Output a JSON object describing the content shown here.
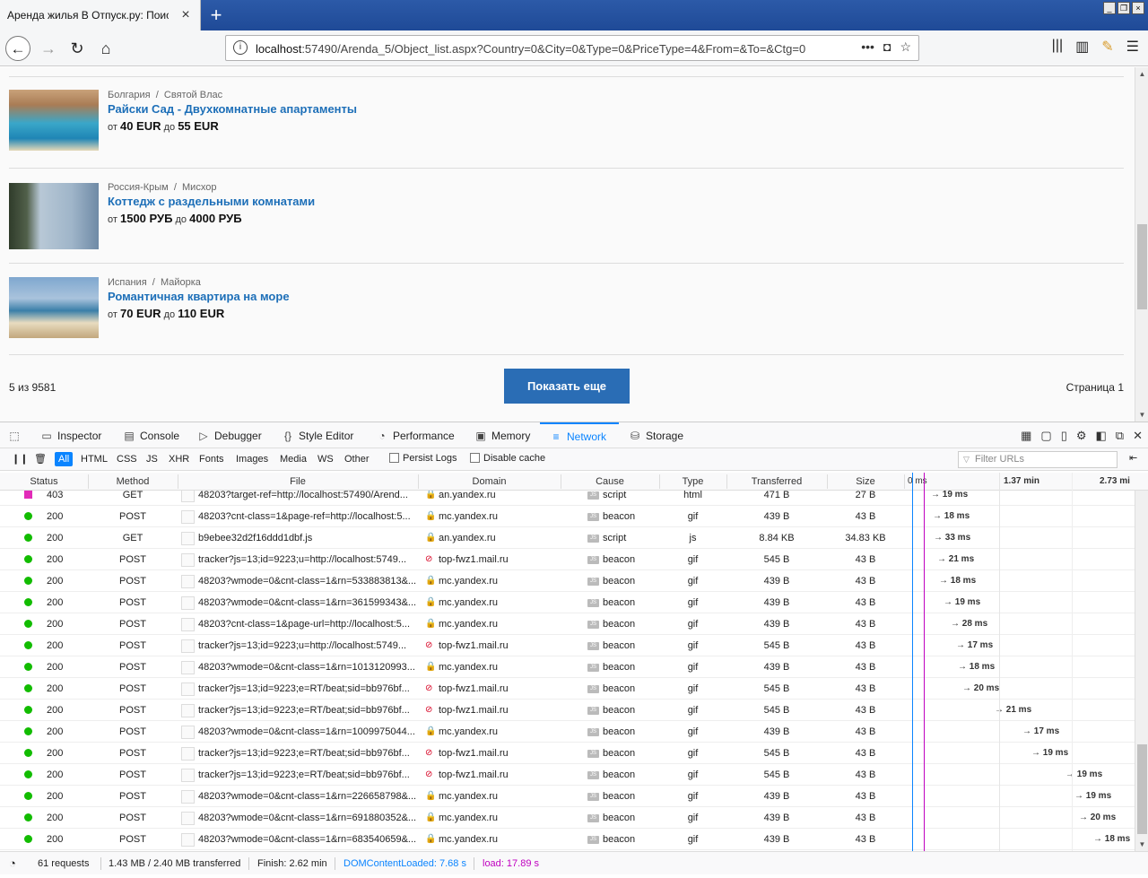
{
  "browser": {
    "tab_title": "Аренда жилья В Отпуск.ру: Поиск об",
    "url_host": "localhost",
    "url_rest": ":57490/Arenda_5/Object_list.aspx?Country=0&City=0&Type=0&PriceType=4&From=&To=&Ctg=0"
  },
  "listing": {
    "items": [
      {
        "country": "Болгария",
        "city": "Святой Влас",
        "title": "Райски Сад - Двухкомнатные апартаменты",
        "from_label": "от",
        "price_from": "40 EUR",
        "to_label": "до",
        "price_to": "55 EUR"
      },
      {
        "country": "Россия-Крым",
        "city": "Мисхор",
        "title": "Коттедж с раздельными комнатами",
        "from_label": "от",
        "price_from": "1500 РУБ",
        "to_label": "до",
        "price_to": "4000 РУБ"
      },
      {
        "country": "Испания",
        "city": "Майорка",
        "title": "Романтичная квартира на море",
        "from_label": "от",
        "price_from": "70 EUR",
        "to_label": "до",
        "price_to": "110 EUR"
      }
    ],
    "count": "5 из 9581",
    "more_button": "Показать еще",
    "page": "Страница 1"
  },
  "devtools": {
    "tabs": [
      "Inspector",
      "Console",
      "Debugger",
      "Style Editor",
      "Performance",
      "Memory",
      "Network",
      "Storage"
    ],
    "filters": [
      "All",
      "HTML",
      "CSS",
      "JS",
      "XHR",
      "Fonts",
      "Images",
      "Media",
      "WS",
      "Other"
    ],
    "persist_logs": "Persist Logs",
    "disable_cache": "Disable cache",
    "filter_placeholder": "Filter URLs",
    "columns": [
      "Status",
      "Method",
      "File",
      "Domain",
      "Cause",
      "Type",
      "Transferred",
      "Size"
    ],
    "timeline_ticks": [
      "0 ms",
      "1.37 min",
      "2.73 mi"
    ],
    "requests": [
      {
        "status": "403",
        "method": "GET",
        "file": "48203?target-ref=http://localhost:57490/Arend...",
        "domain": "an.yandex.ru",
        "secure": true,
        "cause": "script",
        "type": "html",
        "transferred": "471 B",
        "size": "27 B",
        "time": "19 ms",
        "wf": 1038
      },
      {
        "status": "200",
        "method": "POST",
        "file": "48203?cnt-class=1&page-ref=http://localhost:5...",
        "domain": "mc.yandex.ru",
        "secure": true,
        "cause": "beacon",
        "type": "gif",
        "transferred": "439 B",
        "size": "43 B",
        "time": "18 ms",
        "wf": 1040
      },
      {
        "status": "200",
        "method": "GET",
        "file": "b9ebee32d2f16ddd1dbf.js",
        "domain": "an.yandex.ru",
        "secure": true,
        "cause": "script",
        "type": "js",
        "transferred": "8.84 KB",
        "size": "34.83 KB",
        "time": "33 ms",
        "wf": 1041
      },
      {
        "status": "200",
        "method": "POST",
        "file": "tracker?js=13;id=9223;u=http://localhost:5749...",
        "domain": "top-fwz1.mail.ru",
        "secure": false,
        "cause": "beacon",
        "type": "gif",
        "transferred": "545 B",
        "size": "43 B",
        "time": "21 ms",
        "wf": 1045
      },
      {
        "status": "200",
        "method": "POST",
        "file": "48203?wmode=0&cnt-class=1&rn=533883813&...",
        "domain": "mc.yandex.ru",
        "secure": true,
        "cause": "beacon",
        "type": "gif",
        "transferred": "439 B",
        "size": "43 B",
        "time": "18 ms",
        "wf": 1047
      },
      {
        "status": "200",
        "method": "POST",
        "file": "48203?wmode=0&cnt-class=1&rn=361599343&...",
        "domain": "mc.yandex.ru",
        "secure": true,
        "cause": "beacon",
        "type": "gif",
        "transferred": "439 B",
        "size": "43 B",
        "time": "19 ms",
        "wf": 1052
      },
      {
        "status": "200",
        "method": "POST",
        "file": "48203?cnt-class=1&page-url=http://localhost:5...",
        "domain": "mc.yandex.ru",
        "secure": true,
        "cause": "beacon",
        "type": "gif",
        "transferred": "439 B",
        "size": "43 B",
        "time": "28 ms",
        "wf": 1060
      },
      {
        "status": "200",
        "method": "POST",
        "file": "tracker?js=13;id=9223;u=http://localhost:5749...",
        "domain": "top-fwz1.mail.ru",
        "secure": false,
        "cause": "beacon",
        "type": "gif",
        "transferred": "545 B",
        "size": "43 B",
        "time": "17 ms",
        "wf": 1066
      },
      {
        "status": "200",
        "method": "POST",
        "file": "48203?wmode=0&cnt-class=1&rn=1013120993...",
        "domain": "mc.yandex.ru",
        "secure": true,
        "cause": "beacon",
        "type": "gif",
        "transferred": "439 B",
        "size": "43 B",
        "time": "18 ms",
        "wf": 1068
      },
      {
        "status": "200",
        "method": "POST",
        "file": "tracker?js=13;id=9223;e=RT/beat;sid=bb976bf...",
        "domain": "top-fwz1.mail.ru",
        "secure": false,
        "cause": "beacon",
        "type": "gif",
        "transferred": "545 B",
        "size": "43 B",
        "time": "20 ms",
        "wf": 1073
      },
      {
        "status": "200",
        "method": "POST",
        "file": "tracker?js=13;id=9223;e=RT/beat;sid=bb976bf...",
        "domain": "top-fwz1.mail.ru",
        "secure": false,
        "cause": "beacon",
        "type": "gif",
        "transferred": "545 B",
        "size": "43 B",
        "time": "21 ms",
        "wf": 1109
      },
      {
        "status": "200",
        "method": "POST",
        "file": "48203?wmode=0&cnt-class=1&rn=1009975044...",
        "domain": "mc.yandex.ru",
        "secure": true,
        "cause": "beacon",
        "type": "gif",
        "transferred": "439 B",
        "size": "43 B",
        "time": "17 ms",
        "wf": 1140
      },
      {
        "status": "200",
        "method": "POST",
        "file": "tracker?js=13;id=9223;e=RT/beat;sid=bb976bf...",
        "domain": "top-fwz1.mail.ru",
        "secure": false,
        "cause": "beacon",
        "type": "gif",
        "transferred": "545 B",
        "size": "43 B",
        "time": "19 ms",
        "wf": 1150
      },
      {
        "status": "200",
        "method": "POST",
        "file": "tracker?js=13;id=9223;e=RT/beat;sid=bb976bf...",
        "domain": "top-fwz1.mail.ru",
        "secure": false,
        "cause": "beacon",
        "type": "gif",
        "transferred": "545 B",
        "size": "43 B",
        "time": "19 ms",
        "wf": 1188
      },
      {
        "status": "200",
        "method": "POST",
        "file": "48203?wmode=0&cnt-class=1&rn=226658798&...",
        "domain": "mc.yandex.ru",
        "secure": true,
        "cause": "beacon",
        "type": "gif",
        "transferred": "439 B",
        "size": "43 B",
        "time": "19 ms",
        "wf": 1198
      },
      {
        "status": "200",
        "method": "POST",
        "file": "48203?wmode=0&cnt-class=1&rn=691880352&...",
        "domain": "mc.yandex.ru",
        "secure": true,
        "cause": "beacon",
        "type": "gif",
        "transferred": "439 B",
        "size": "43 B",
        "time": "20 ms",
        "wf": 1203
      },
      {
        "status": "200",
        "method": "POST",
        "file": "48203?wmode=0&cnt-class=1&rn=683540659&...",
        "domain": "mc.yandex.ru",
        "secure": true,
        "cause": "beacon",
        "type": "gif",
        "transferred": "439 B",
        "size": "43 B",
        "time": "18 ms",
        "wf": 1219
      }
    ],
    "summary": {
      "requests": "61 requests",
      "transferred": "1.43 MB / 2.40 MB transferred",
      "finish": "Finish: 2.62 min",
      "dom": "DOMContentLoaded: 7.68 s",
      "load": "load: 17.89 s"
    }
  },
  "colors": {
    "accent": "#0a84ff",
    "link": "#1d6fb8",
    "button": "#2a6db5",
    "ok": "#12bc00",
    "error": "#e22bb8",
    "load": "#c000c0"
  }
}
